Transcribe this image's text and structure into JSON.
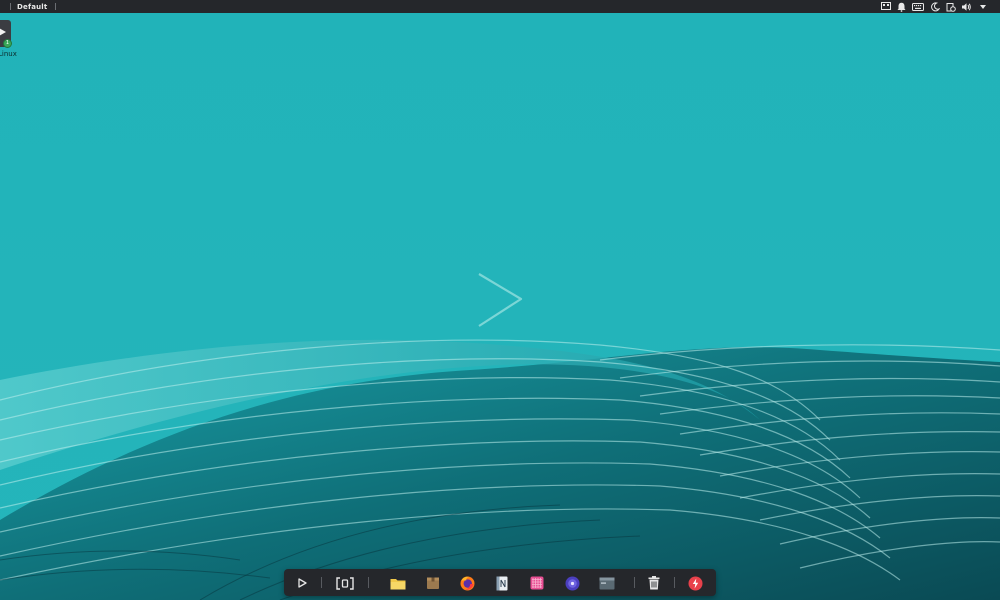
{
  "top_panel": {
    "workspace_label": "Default",
    "tray_icons": [
      "keyboard-layout-icon",
      "notification-bell-icon",
      "keyboard-icon",
      "night-light-icon",
      "clipboard-timer-icon",
      "volume-icon",
      "dropdown-arrow-icon"
    ]
  },
  "desktop": {
    "icons": [
      {
        "label": "Linux",
        "icon": "terminal-launcher-icon",
        "badge": "1"
      }
    ],
    "wallpaper": {
      "accent": "#21b3b9",
      "logo": "play-triangle-logo"
    }
  },
  "dock": {
    "items": [
      {
        "name": "app-launcher",
        "icon": "play-triangle-icon"
      },
      {
        "name": "workspaces",
        "icon": "bracket-workspaces-icon"
      },
      {
        "name": "files",
        "icon": "folder-icon"
      },
      {
        "name": "archive",
        "icon": "package-icon"
      },
      {
        "name": "firefox",
        "icon": "firefox-icon"
      },
      {
        "name": "notes",
        "icon": "notes-icon"
      },
      {
        "name": "pink-app",
        "icon": "grid-app-icon"
      },
      {
        "name": "media-player",
        "icon": "disc-icon"
      },
      {
        "name": "terminal",
        "icon": "terminal-window-icon"
      },
      {
        "name": "trash",
        "icon": "trash-icon"
      },
      {
        "name": "power",
        "icon": "power-icon"
      }
    ]
  },
  "colors": {
    "panel": "#25272b",
    "wallpaper_light": "#21b3b9",
    "wallpaper_dark": "#0e5a63"
  }
}
